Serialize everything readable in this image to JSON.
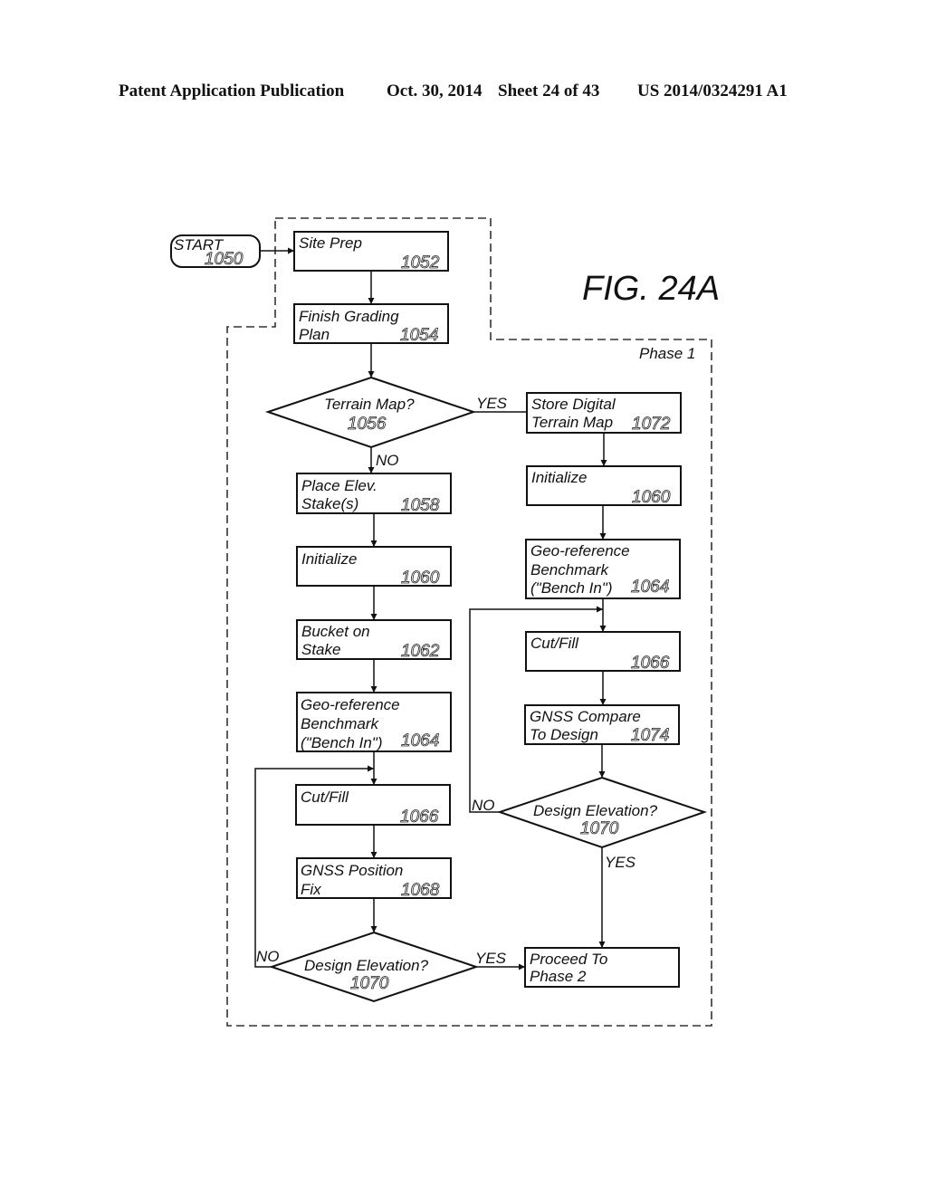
{
  "header": {
    "publication": "Patent Application Publication",
    "date": "Oct. 30, 2014",
    "sheet": "Sheet 24 of 43",
    "number": "US 2014/0324291 A1"
  },
  "figure": {
    "title": "FIG. 24A",
    "phase_label": "Phase 1"
  },
  "nodes": {
    "start": {
      "label": "START",
      "ref": "1050"
    },
    "site_prep": {
      "line1": "Site Prep",
      "ref": "1052"
    },
    "finish_grading": {
      "line1": "Finish Grading",
      "line2": "Plan",
      "ref": "1054"
    },
    "terrain_map": {
      "line1": "Terrain Map?",
      "ref": "1056"
    },
    "store_dtm": {
      "line1": "Store Digital",
      "line2": "Terrain Map",
      "ref": "1072"
    },
    "place_stakes": {
      "line1": "Place Elev.",
      "line2": "Stake(s)",
      "ref": "1058"
    },
    "init_left": {
      "line1": "Initialize",
      "ref": "1060"
    },
    "init_right": {
      "line1": "Initialize",
      "ref": "1060"
    },
    "bucket": {
      "line1": "Bucket on",
      "line2": "Stake",
      "ref": "1062"
    },
    "georef_left": {
      "line1": "Geo-reference",
      "line2": "Benchmark",
      "line3": "(\"Bench In\")",
      "ref": "1064"
    },
    "georef_right": {
      "line1": "Geo-reference",
      "line2": "Benchmark",
      "line3": "(\"Bench In\")",
      "ref": "1064"
    },
    "cutfill_left": {
      "line1": "Cut/Fill",
      "ref": "1066"
    },
    "cutfill_right": {
      "line1": "Cut/Fill",
      "ref": "1066"
    },
    "gnss_fix": {
      "line1": "GNSS Position",
      "line2": "Fix",
      "ref": "1068"
    },
    "gnss_compare": {
      "line1": "GNSS Compare",
      "line2": "To Design",
      "ref": "1074"
    },
    "design_left": {
      "line1": "Design Elevation?",
      "ref": "1070"
    },
    "design_right": {
      "line1": "Design Elevation?",
      "ref": "1070"
    },
    "proceed": {
      "line1": "Proceed To",
      "line2": "Phase 2"
    }
  },
  "edge_labels": {
    "yes": "YES",
    "no": "NO"
  }
}
